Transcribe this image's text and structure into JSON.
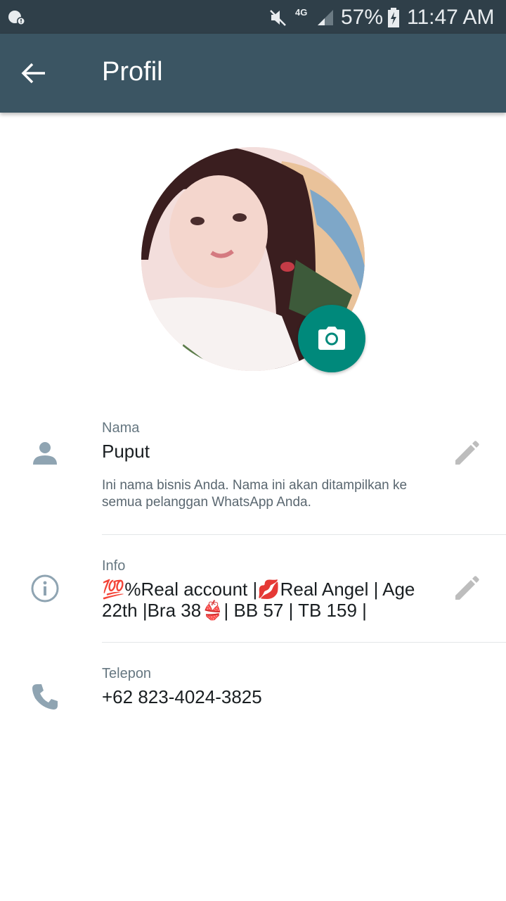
{
  "status_bar": {
    "network": "4G",
    "battery_percent": "57%",
    "time": "11:47 AM"
  },
  "header": {
    "title": "Profil"
  },
  "profile": {
    "name_section": {
      "label": "Nama",
      "value": "Puput",
      "hint": "Ini nama bisnis Anda. Nama ini akan ditampilkan ke semua pelanggan WhatsApp Anda."
    },
    "info_section": {
      "label": "Info",
      "value": "💯%Real account |💋Real Angel | Age 22th |Bra 38👙| BB 57 | TB 159 |"
    },
    "phone_section": {
      "label": "Telepon",
      "value": "+62 823-4024-3825"
    }
  },
  "colors": {
    "status_bar": "#2f3f49",
    "app_bar": "#3b5563",
    "accent": "#00897b",
    "icon_grey": "#8fa4b2"
  }
}
